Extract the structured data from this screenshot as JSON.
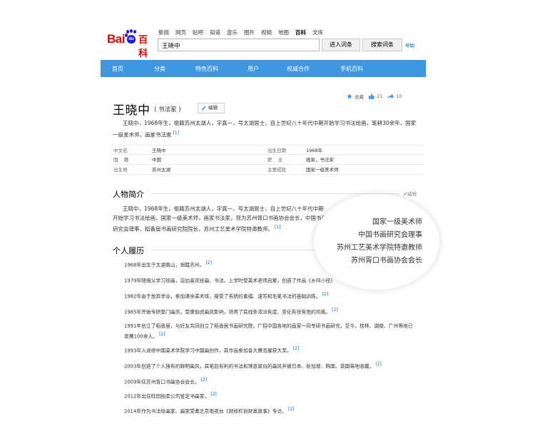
{
  "logo": {
    "bai": "Bai",
    "du": "du",
    "baike": "百科"
  },
  "topnav": [
    {
      "label": "新闻",
      "active": false
    },
    {
      "label": "网页",
      "active": false
    },
    {
      "label": "贴吧",
      "active": false
    },
    {
      "label": "知道",
      "active": false
    },
    {
      "label": "音乐",
      "active": false
    },
    {
      "label": "图片",
      "active": false
    },
    {
      "label": "视频",
      "active": false
    },
    {
      "label": "地图",
      "active": false
    },
    {
      "label": "百科",
      "active": true
    },
    {
      "label": "文库",
      "active": false
    }
  ],
  "search": {
    "value": "王晓中",
    "enter_label": "进入词条",
    "search_label": "搜索词条",
    "help_label": "帮助"
  },
  "navbar": [
    "首页",
    "分类",
    "特色百科",
    "用户",
    "权威合作",
    "手机百科"
  ],
  "article": {
    "title": "王晓中",
    "subtitle": "( 书法家 )",
    "edit_label": "编辑",
    "stats": {
      "collect": "收藏",
      "likes": "21",
      "shares": "10"
    },
    "summary": "王晓中，1968年生，祖籍苏州太湖人，字真一，号太湖居士，自上世纪八十年代中期开始学习书法绘画，笔耕30余年，国家一级美术师，画家书法家",
    "summary_ref": "[1]"
  },
  "info": [
    {
      "k1": "中文名",
      "v1": "王晓中",
      "k2": "出生日期",
      "v2": "1968年"
    },
    {
      "k1": "国    籍",
      "v1": "中国",
      "k2": "职    业",
      "v2": "画家，书法家"
    },
    {
      "k1": "出生地",
      "v1": "苏州太湖",
      "k2": "主要成就",
      "v2": "国家一级美术师"
    }
  ],
  "sections": {
    "intro_title": "人物简介",
    "intro_edit": "编辑",
    "intro_text": "王晓中，1968年生，祖籍苏州太湖人，字真一，号太湖居士，自上世纪八十年代中期开始学习书法绘画，国家一级美术师，画家书法家，现为苏州胥口书画协会会长，中国书画研究会理事，稻香居书画研究院院长，苏州工艺美术学院特邀教师。",
    "intro_ref": "[1]",
    "career_title": "个人履历"
  },
  "magnifier": [
    "国家一级美术师",
    "中国书画研究会理事",
    "苏州工艺美术学院特邀教师",
    "苏州胥口书画协会会长"
  ],
  "career": [
    {
      "text": "1968年出生于太湖香山，祖籍苏州。",
      "ref": "[2]"
    },
    {
      "text": "1979年随祖父学习绘画，自幼喜欢绘画、书法。上学时受美术老师启蒙，创造了作品《乡间小径》",
      "ref": ""
    },
    {
      "text": "1982年由于放弃学业，参加课余美术班，接受了系统的素描、速写和毛笔书法的基础训练。",
      "ref": "[2]"
    },
    {
      "text": "1985年开始专研吴门画风，受唐伯虎画风影响，培育了其线条浓淡有度、变化有张有弛的风格。",
      "ref": "[2]"
    },
    {
      "text": "1991年创立了稻香居，与好友共同创立了稻香居书画研究院，广招中国各地的画家一同专研书画研究，至今，桂林、湖南、广州等地已发展100余人。",
      "ref": "[2]"
    },
    {
      "text": "1993年入进修中国美术学院学习中国画创作，其作品参加各大展览屡获大奖。",
      "ref": "[2]"
    },
    {
      "text": "2003年创造了个人独有的鲜明画风，其笔劲有利的书法和博意留白的画风并被日本、新加坡、韩国、英国等地收藏。",
      "ref": "[2]"
    },
    {
      "text": "2009年任苏州胥口书画协会会长。",
      "ref": "[2]"
    },
    {
      "text": "2012年出任旺田拍卖公司鉴定书画家。",
      "ref": "[2]"
    },
    {
      "text": "2014年作为书法绘画家、画家受邀北京电视台《财经栏目财富故事》专访。",
      "ref": "[2]"
    }
  ]
}
